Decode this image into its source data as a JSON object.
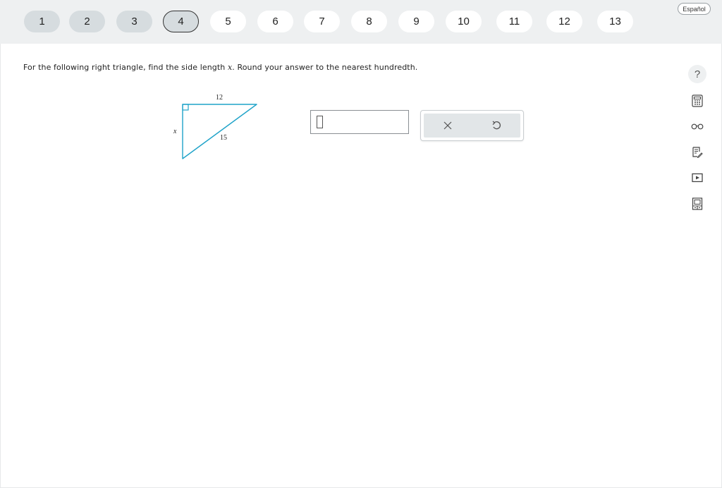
{
  "nav": {
    "questions": [
      "1",
      "2",
      "3",
      "4",
      "5",
      "6",
      "7",
      "8",
      "9",
      "10",
      "11",
      "12",
      "13"
    ],
    "current": "4",
    "visited": [
      "1",
      "2",
      "3",
      "4"
    ],
    "language_label": "Español"
  },
  "question": {
    "text_before": "For the following right triangle, find the side length ",
    "variable": "x",
    "text_after": ". Round your answer to the nearest hundredth."
  },
  "figure": {
    "top_label": "12",
    "left_label": "x",
    "hypotenuse_label": "15",
    "stroke_color": "#1fa3c9"
  },
  "answer": {
    "value": ""
  },
  "keypad": {
    "clear_icon": "close-icon",
    "undo_icon": "undo-icon"
  },
  "tools": {
    "help_label": "?",
    "icons": [
      "help-icon",
      "calculator-icon",
      "glasses-icon",
      "notepad-icon",
      "video-icon",
      "reference-icon"
    ]
  },
  "colors": {
    "top_bar": "#eef0f1",
    "visited_bg": "#d6dcdf",
    "figure_stroke": "#1fa3c9"
  }
}
